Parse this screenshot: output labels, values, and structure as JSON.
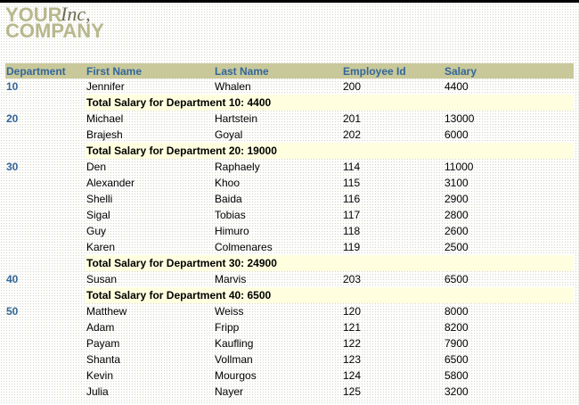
{
  "logo": {
    "line1": "YOUR",
    "inc": "Inc,",
    "line2": "COMPANY"
  },
  "columns": [
    "Department",
    "First Name",
    "Last Name",
    "Employee Id",
    "Salary"
  ],
  "rows": [
    {
      "type": "emp",
      "dept": "10",
      "first": "Jennifer",
      "last": "Whalen",
      "id": "200",
      "salary": "4400"
    },
    {
      "type": "total",
      "text": "Total Salary for Department 10: 4400"
    },
    {
      "type": "emp",
      "dept": "20",
      "first": "Michael",
      "last": "Hartstein",
      "id": "201",
      "salary": "13000"
    },
    {
      "type": "emp",
      "dept": "",
      "first": "Brajesh",
      "last": "Goyal",
      "id": "202",
      "salary": "6000"
    },
    {
      "type": "total",
      "text": "Total Salary for Department 20: 19000"
    },
    {
      "type": "emp",
      "dept": "30",
      "first": "Den",
      "last": "Raphaely",
      "id": "114",
      "salary": "11000"
    },
    {
      "type": "emp",
      "dept": "",
      "first": "Alexander",
      "last": "Khoo",
      "id": "115",
      "salary": "3100"
    },
    {
      "type": "emp",
      "dept": "",
      "first": "Shelli",
      "last": "Baida",
      "id": "116",
      "salary": "2900"
    },
    {
      "type": "emp",
      "dept": "",
      "first": "Sigal",
      "last": "Tobias",
      "id": "117",
      "salary": "2800"
    },
    {
      "type": "emp",
      "dept": "",
      "first": "Guy",
      "last": "Himuro",
      "id": "118",
      "salary": "2600"
    },
    {
      "type": "emp",
      "dept": "",
      "first": "Karen",
      "last": "Colmenares",
      "id": "119",
      "salary": "2500"
    },
    {
      "type": "total",
      "text": "Total Salary for Department 30: 24900"
    },
    {
      "type": "emp",
      "dept": "40",
      "first": "Susan",
      "last": "Marvis",
      "id": "203",
      "salary": "6500"
    },
    {
      "type": "total",
      "text": "Total Salary for Department 40: 6500"
    },
    {
      "type": "emp",
      "dept": "50",
      "first": "Matthew",
      "last": "Weiss",
      "id": "120",
      "salary": "8000"
    },
    {
      "type": "emp",
      "dept": "",
      "first": "Adam",
      "last": "Fripp",
      "id": "121",
      "salary": "8200"
    },
    {
      "type": "emp",
      "dept": "",
      "first": "Payam",
      "last": "Kaufling",
      "id": "122",
      "salary": "7900"
    },
    {
      "type": "emp",
      "dept": "",
      "first": "Shanta",
      "last": "Vollman",
      "id": "123",
      "salary": "6500"
    },
    {
      "type": "emp",
      "dept": "",
      "first": "Kevin",
      "last": "Mourgos",
      "id": "124",
      "salary": "5800"
    },
    {
      "type": "emp",
      "dept": "",
      "first": "Julia",
      "last": "Nayer",
      "id": "125",
      "salary": "3200"
    }
  ]
}
